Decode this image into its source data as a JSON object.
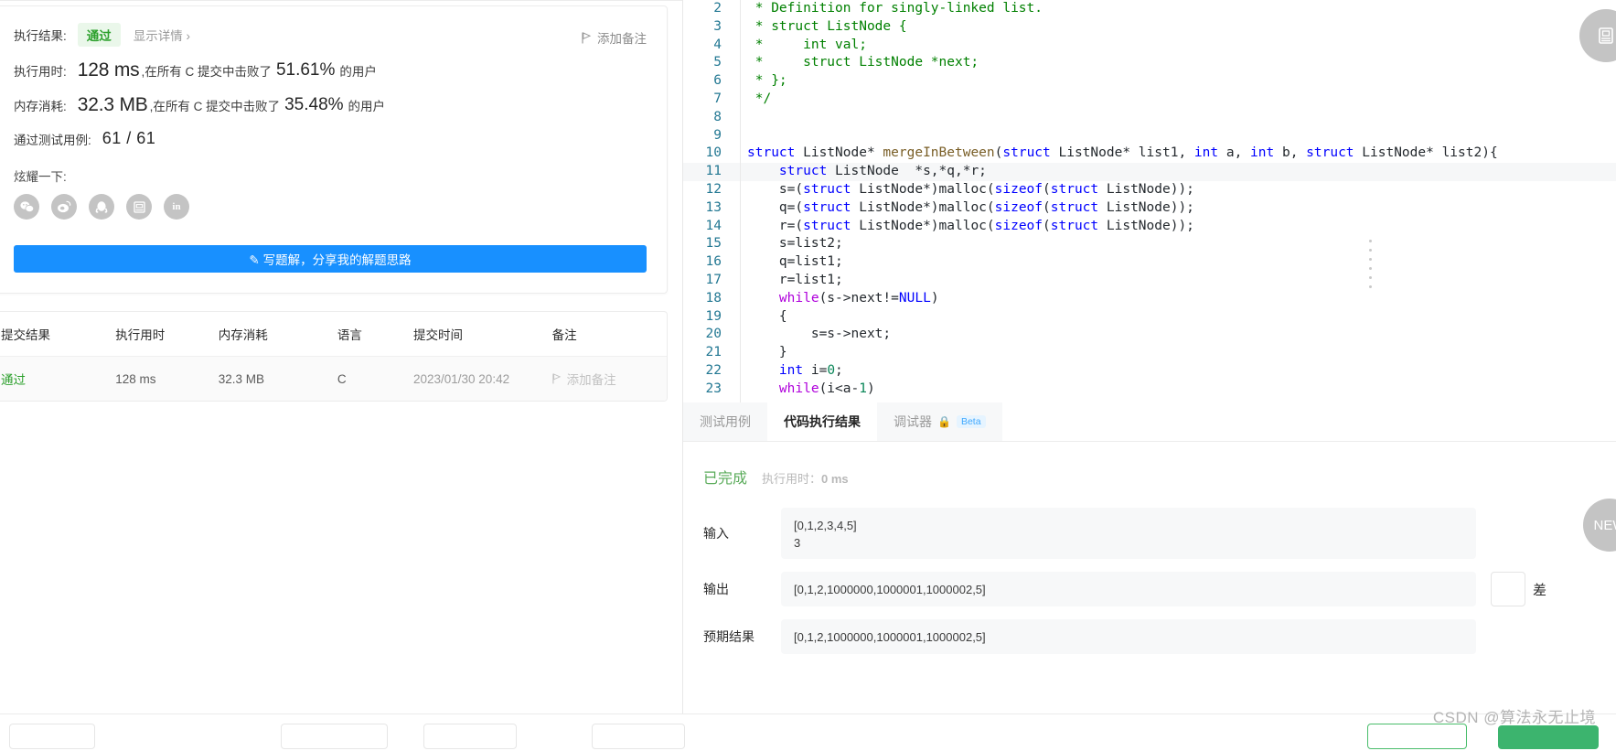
{
  "result_card": {
    "exec_result_label": "执行结果:",
    "status_badge": "通过",
    "detail_link": "显示详情 ›",
    "add_note": "添加备注",
    "runtime_label": "执行用时:",
    "runtime_value": "128 ms",
    "runtime_text_1": ",在所有 C 提交中击败了",
    "runtime_pct": "51.61%",
    "runtime_text_2": "的用户",
    "memory_label": "内存消耗:",
    "memory_value": "32.3 MB",
    "memory_text_1": ",在所有 C 提交中击败了",
    "memory_pct": "35.48%",
    "memory_text_2": "的用户",
    "cases_label": "通过测试用例:",
    "cases_value": "61 / 61",
    "flaunt_label": "炫耀一下:",
    "share_icons": [
      {
        "name": "wechat-icon",
        "glyph": "✆"
      },
      {
        "name": "weibo-icon",
        "glyph": "◎"
      },
      {
        "name": "qq-icon",
        "glyph": "🐧"
      },
      {
        "name": "douban-icon",
        "glyph": "豆"
      },
      {
        "name": "linkedin-icon",
        "glyph": "in"
      }
    ],
    "write_solution_button": "写题解，分享我的解题思路"
  },
  "submissions_table": {
    "headers": [
      "提交结果",
      "执行用时",
      "内存消耗",
      "语言",
      "提交时间",
      "备注"
    ],
    "rows": [
      {
        "result": "通过",
        "runtime": "128 ms",
        "memory": "32.3 MB",
        "language": "C",
        "time": "2023/01/30 20:42",
        "note": "添加备注"
      }
    ]
  },
  "editor": {
    "lines": [
      {
        "no": "2",
        "tokens": [
          {
            "t": "cm",
            "v": " * Definition for singly-linked list."
          }
        ]
      },
      {
        "no": "3",
        "tokens": [
          {
            "t": "cm",
            "v": " * struct ListNode {"
          }
        ]
      },
      {
        "no": "4",
        "tokens": [
          {
            "t": "cm",
            "v": " *     int val;"
          }
        ]
      },
      {
        "no": "5",
        "tokens": [
          {
            "t": "cm",
            "v": " *     struct ListNode *next;"
          }
        ]
      },
      {
        "no": "6",
        "tokens": [
          {
            "t": "cm",
            "v": " * };"
          }
        ]
      },
      {
        "no": "7",
        "tokens": [
          {
            "t": "cm",
            "v": " */"
          }
        ]
      },
      {
        "no": "8",
        "tokens": [
          {
            "t": "pl",
            "v": ""
          }
        ]
      },
      {
        "no": "9",
        "tokens": [
          {
            "t": "pl",
            "v": ""
          }
        ]
      },
      {
        "no": "10",
        "tokens": [
          {
            "t": "kw",
            "v": "struct"
          },
          {
            "t": "pl",
            "v": " ListNode* "
          },
          {
            "t": "fn",
            "v": "mergeInBetween"
          },
          {
            "t": "pl",
            "v": "("
          },
          {
            "t": "kw",
            "v": "struct"
          },
          {
            "t": "pl",
            "v": " ListNode* list1, "
          },
          {
            "t": "kw",
            "v": "int"
          },
          {
            "t": "pl",
            "v": " a, "
          },
          {
            "t": "kw",
            "v": "int"
          },
          {
            "t": "pl",
            "v": " b, "
          },
          {
            "t": "kw",
            "v": "struct"
          },
          {
            "t": "pl",
            "v": " ListNode* list2){"
          }
        ]
      },
      {
        "no": "11",
        "highlight": true,
        "tokens": [
          {
            "t": "pl",
            "v": "    "
          },
          {
            "t": "kw",
            "v": "struct"
          },
          {
            "t": "pl",
            "v": " ListNode  *s,*q,*r;"
          }
        ]
      },
      {
        "no": "12",
        "tokens": [
          {
            "t": "pl",
            "v": "    s=("
          },
          {
            "t": "kw",
            "v": "struct"
          },
          {
            "t": "pl",
            "v": " ListNode*)malloc("
          },
          {
            "t": "kw",
            "v": "sizeof"
          },
          {
            "t": "pl",
            "v": "("
          },
          {
            "t": "kw",
            "v": "struct"
          },
          {
            "t": "pl",
            "v": " ListNode));"
          }
        ]
      },
      {
        "no": "13",
        "tokens": [
          {
            "t": "pl",
            "v": "    q=("
          },
          {
            "t": "kw",
            "v": "struct"
          },
          {
            "t": "pl",
            "v": " ListNode*)malloc("
          },
          {
            "t": "kw",
            "v": "sizeof"
          },
          {
            "t": "pl",
            "v": "("
          },
          {
            "t": "kw",
            "v": "struct"
          },
          {
            "t": "pl",
            "v": " ListNode));"
          }
        ]
      },
      {
        "no": "14",
        "tokens": [
          {
            "t": "pl",
            "v": "    r=("
          },
          {
            "t": "kw",
            "v": "struct"
          },
          {
            "t": "pl",
            "v": " ListNode*)malloc("
          },
          {
            "t": "kw",
            "v": "sizeof"
          },
          {
            "t": "pl",
            "v": "("
          },
          {
            "t": "kw",
            "v": "struct"
          },
          {
            "t": "pl",
            "v": " ListNode));"
          }
        ]
      },
      {
        "no": "15",
        "tokens": [
          {
            "t": "pl",
            "v": "    s=list2;"
          }
        ]
      },
      {
        "no": "16",
        "tokens": [
          {
            "t": "pl",
            "v": "    q=list1;"
          }
        ]
      },
      {
        "no": "17",
        "tokens": [
          {
            "t": "pl",
            "v": "    r=list1;"
          }
        ]
      },
      {
        "no": "18",
        "tokens": [
          {
            "t": "kw2",
            "v": "    while"
          },
          {
            "t": "pl",
            "v": "(s->next!="
          },
          {
            "t": "kw",
            "v": "NULL"
          },
          {
            "t": "pl",
            "v": ")"
          }
        ]
      },
      {
        "no": "19",
        "tokens": [
          {
            "t": "pl",
            "v": "    {"
          }
        ]
      },
      {
        "no": "20",
        "tokens": [
          {
            "t": "pl",
            "v": "        s=s->next;"
          }
        ]
      },
      {
        "no": "21",
        "tokens": [
          {
            "t": "pl",
            "v": "    }"
          }
        ]
      },
      {
        "no": "22",
        "tokens": [
          {
            "t": "kw",
            "v": "    int"
          },
          {
            "t": "pl",
            "v": " i="
          },
          {
            "t": "num",
            "v": "0"
          },
          {
            "t": "pl",
            "v": ";"
          }
        ]
      },
      {
        "no": "23",
        "tokens": [
          {
            "t": "kw2",
            "v": "    while"
          },
          {
            "t": "pl",
            "v": "(i<a-"
          },
          {
            "t": "num",
            "v": "1"
          },
          {
            "t": "pl",
            "v": ")"
          }
        ]
      }
    ]
  },
  "tabs": [
    {
      "label": "测试用例",
      "active": false
    },
    {
      "label": "代码执行结果",
      "active": true
    },
    {
      "label": "调试器",
      "active": false,
      "lock": "🔒",
      "badge": "Beta"
    }
  ],
  "results": {
    "status": "已完成",
    "runtime_label": "执行用时：",
    "runtime_value": "0 ms",
    "input_label": "输入",
    "input_value": "[0,1,2,3,4,5]\n3",
    "output_label": "输出",
    "output_value": "[0,1,2,1000000,1000001,1000002,5]",
    "expected_label": "预期结果",
    "expected_value": "[0,1,2,1000000,1000001,1000002,5]",
    "diff_label": "差"
  },
  "floating": {
    "note_button": "📖",
    "new_button": "NEW"
  },
  "watermark": "CSDN @算法永无止境",
  "colors": {
    "accent_blue": "#1890ff",
    "pass_green": "#2ca02c",
    "panel_gray": "#f7f8f9"
  }
}
